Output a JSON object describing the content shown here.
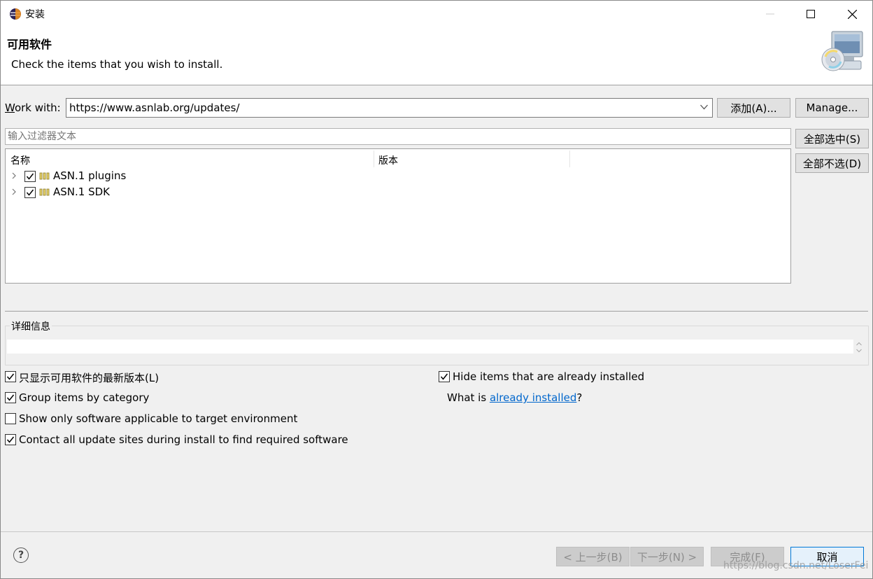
{
  "window": {
    "title": "安装"
  },
  "banner": {
    "title": "可用软件",
    "description": "Check the items that you wish to install."
  },
  "work_with": {
    "label": "Work with:",
    "value": "https://www.asnlab.org/updates/",
    "add_button": "添加(A)...",
    "manage_button": "Manage..."
  },
  "filter": {
    "placeholder": "输入过滤器文本"
  },
  "selection_buttons": {
    "select_all": "全部选中(S)",
    "deselect_all": "全部不选(D)"
  },
  "tree": {
    "columns": [
      "名称",
      "版本"
    ],
    "items": [
      {
        "label": "ASN.1 plugins",
        "checked": true
      },
      {
        "label": "ASN.1 SDK",
        "checked": true
      }
    ]
  },
  "details": {
    "label": "详细信息"
  },
  "options": {
    "latest_only": {
      "label": "只显示可用软件的最新版本(L)",
      "checked": true
    },
    "group_by_category": {
      "label": "Group items by category",
      "checked": true
    },
    "target_env_only": {
      "label": "Show only software applicable to target environment",
      "checked": false
    },
    "contact_all_sites": {
      "label": "Contact all update sites during install to find required software",
      "checked": true
    },
    "hide_installed": {
      "label": "Hide items that are already installed",
      "checked": true
    },
    "what_is_prefix": "What is ",
    "what_is_link": "already installed",
    "what_is_suffix": "?"
  },
  "footer": {
    "help": "?",
    "back": "< 上一步(B)",
    "next": "下一步(N) >",
    "finish": "完成(F)",
    "cancel": "取消",
    "watermark": "https://blog.csdn.net/LoserFei"
  }
}
